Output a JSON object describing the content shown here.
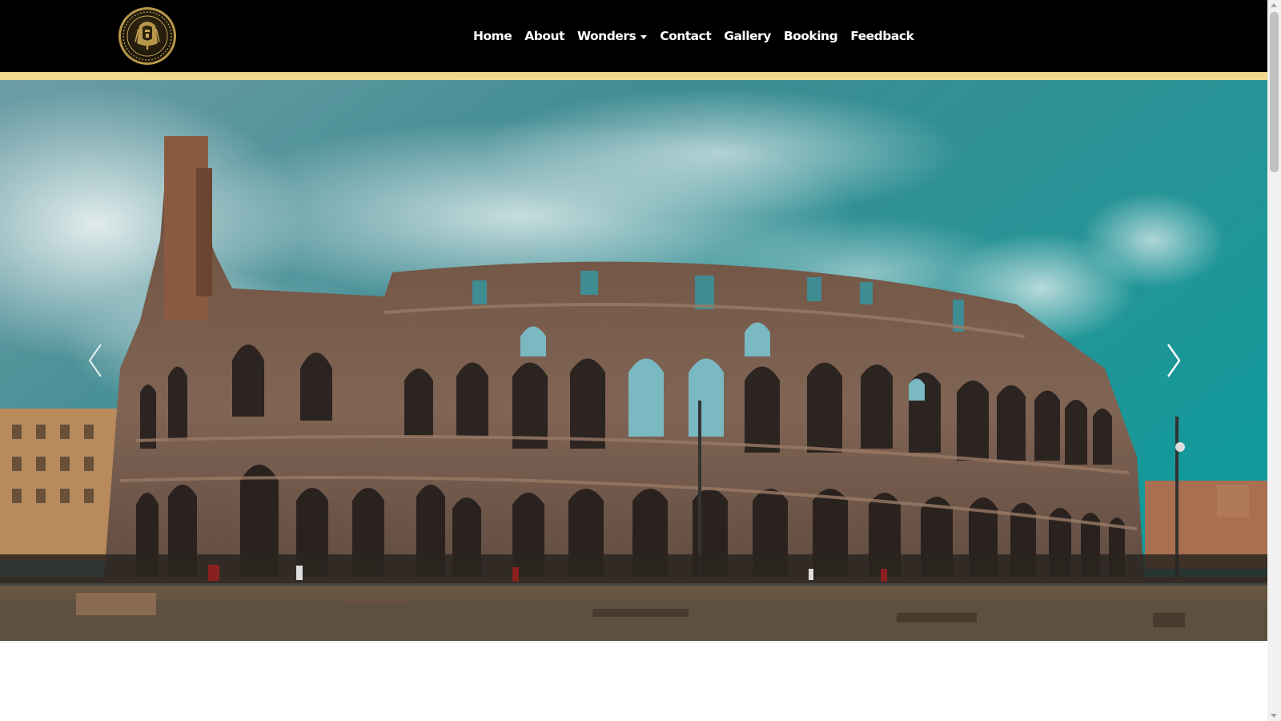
{
  "navbar": {
    "logo_icon": "pharaoh-medallion-icon",
    "links": [
      {
        "label": "Home"
      },
      {
        "label": "About"
      },
      {
        "label": "Wonders",
        "dropdown": true
      },
      {
        "label": "Contact"
      },
      {
        "label": "Gallery"
      },
      {
        "label": "Booking"
      },
      {
        "label": "Feedback"
      }
    ],
    "background_color": "#000000",
    "accent_stripe_color": "#f0d98c"
  },
  "carousel": {
    "slide_image": "colosseum-photo",
    "prev_icon": "chevron-left-icon",
    "next_icon": "chevron-right-icon"
  }
}
